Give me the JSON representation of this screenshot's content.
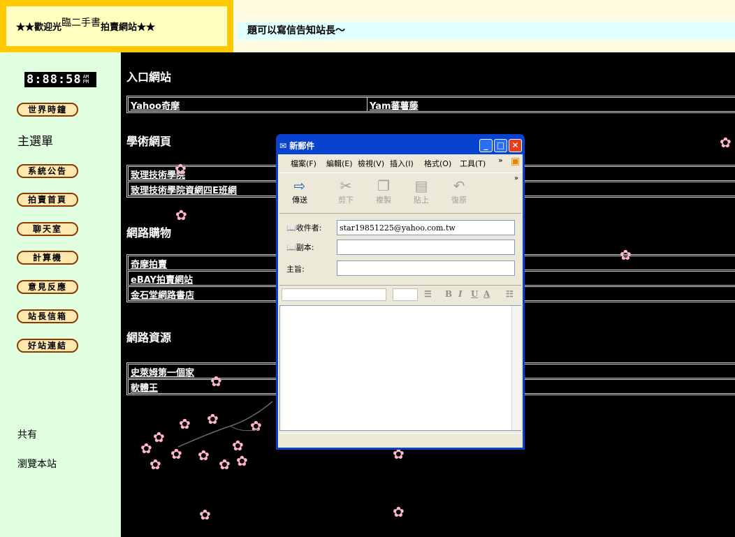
{
  "banner": {
    "welcome_prefix": "★★歡迎光",
    "welcome_mid": "臨二手書",
    "welcome_suffix": "拍賣網站★★",
    "marquee": "題可以寫信告知站長～"
  },
  "sidebar": {
    "clock": "8:88:58",
    "clock_am": "AM",
    "clock_pm": "PM",
    "world_time": "世界時鐘",
    "main_menu": "主選單",
    "buttons": [
      "系統公告",
      "拍賣首頁",
      "聊天室",
      "計算機",
      "意見反應",
      "站長信箱",
      "好站連結"
    ],
    "total_label": "共有",
    "visits_label": "瀏覽本站"
  },
  "main": {
    "sections": [
      {
        "title": "入口網站",
        "links": [
          "Yahoo奇摩",
          "Yam蕃薯藤"
        ]
      },
      {
        "title": "學術網頁",
        "links": [
          "致理技術學院",
          "致理技術學院資網四E班網"
        ]
      },
      {
        "title": "網路購物",
        "links": [
          "奇摩拍賣",
          "eBAY拍賣網站",
          "金石堂網路書店"
        ]
      },
      {
        "title": "網路資源",
        "links": [
          "史萊姆第一個家",
          "軟體王"
        ]
      }
    ],
    "flower_glyph": "✿"
  },
  "mail": {
    "title": "新郵件",
    "menu": [
      "檔案(F)",
      "編輯(E)",
      "檢視(V)",
      "插入(I)",
      "格式(O)",
      "工具(T)",
      "»"
    ],
    "toolbar": [
      {
        "label": "傳送",
        "icon": "send-icon"
      },
      {
        "label": "剪下",
        "icon": "cut-icon"
      },
      {
        "label": "複製",
        "icon": "copy-icon"
      },
      {
        "label": "貼上",
        "icon": "paste-icon"
      },
      {
        "label": "復原",
        "icon": "undo-icon"
      }
    ],
    "to_label": "收件者:",
    "cc_label": "副本:",
    "subject_label": "主旨:",
    "to_value": "star19851225@yahoo.com.tw",
    "cc_value": "",
    "subject_value": "",
    "format_buttons": [
      "B",
      "I",
      "U",
      "A"
    ]
  },
  "colors": {
    "banner_border": "#ffc800",
    "sidebar_bg": "#e0ffe0",
    "main_bg": "#000000",
    "xp_blue": "#0842d0",
    "flower": "#ffb6c8"
  }
}
